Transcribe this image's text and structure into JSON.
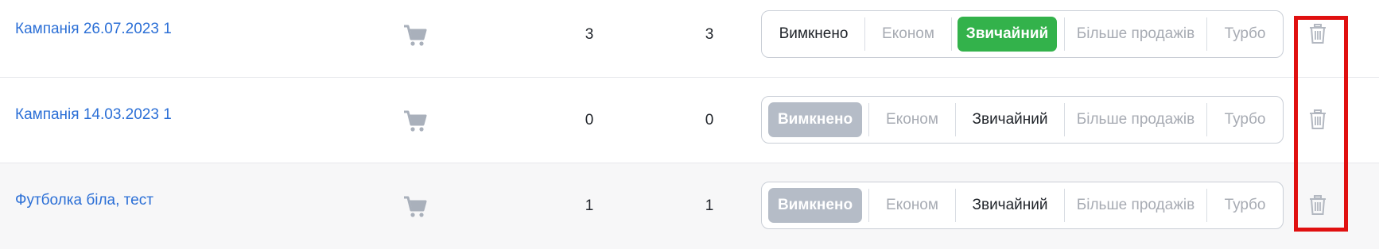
{
  "modes": {
    "off": "Вимкнено",
    "econom": "Економ",
    "normal": "Звичайний",
    "more_sales": "Більше продажів",
    "turbo": "Турбо"
  },
  "campaigns": [
    {
      "name": "Кампанія 26.07.2023 1",
      "count_a": "3",
      "count_b": "3",
      "active_mode": "normal"
    },
    {
      "name": "Кампанія 14.03.2023 1",
      "count_a": "0",
      "count_b": "0",
      "active_mode": "off"
    },
    {
      "name": "Футболка біла, тест",
      "count_a": "1",
      "count_b": "1",
      "active_mode": "off"
    }
  ],
  "colors": {
    "link": "#2b6fd6",
    "active_green": "#33b24b",
    "active_gray": "#b5bcc7",
    "highlight": "#e01010"
  },
  "icons": {
    "cart": "shopping-cart-icon",
    "delete": "trash-icon"
  }
}
